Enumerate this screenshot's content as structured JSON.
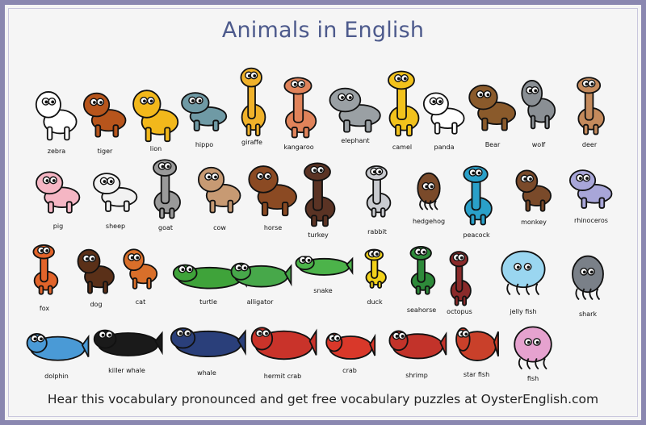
{
  "title": "Animals in English",
  "footer": "Hear this vocabulary pronounced and get free vocabulary puzzles at OysterEnglish.com",
  "animals": [
    {
      "label": "zebra",
      "color": "#ffffff"
    },
    {
      "label": "tiger",
      "color": "#b7551c"
    },
    {
      "label": "lion",
      "color": "#f2b81b"
    },
    {
      "label": "hippo",
      "color": "#6f9aa5"
    },
    {
      "label": "giraffe",
      "color": "#f0b22a"
    },
    {
      "label": "kangaroo",
      "color": "#e0835a"
    },
    {
      "label": "elephant",
      "color": "#9aa0a4"
    },
    {
      "label": "camel",
      "color": "#f2c21c"
    },
    {
      "label": "panda",
      "color": "#ffffff"
    },
    {
      "label": "Bear",
      "color": "#8a5a2b"
    },
    {
      "label": "wolf",
      "color": "#8a8f94"
    },
    {
      "label": "deer",
      "color": "#c48a5c"
    },
    {
      "label": "pig",
      "color": "#f5b6c4"
    },
    {
      "label": "sheep",
      "color": "#f2f2f2"
    },
    {
      "label": "goat",
      "color": "#9a9a9a"
    },
    {
      "label": "cow",
      "color": "#c79a73"
    },
    {
      "label": "horse",
      "color": "#8b4a23"
    },
    {
      "label": "turkey",
      "color": "#5a3324"
    },
    {
      "label": "rabbit",
      "color": "#c9cbd0"
    },
    {
      "label": "hedgehog",
      "color": "#7a4a2a"
    },
    {
      "label": "peacock",
      "color": "#2aa0c9"
    },
    {
      "label": "monkey",
      "color": "#7a4a2a"
    },
    {
      "label": "rhinoceros",
      "color": "#a8a6d8"
    },
    {
      "label": "fox",
      "color": "#e2642a"
    },
    {
      "label": "dog",
      "color": "#5a3018"
    },
    {
      "label": "cat",
      "color": "#d96f2a"
    },
    {
      "label": "turtle",
      "color": "#3fa33a"
    },
    {
      "label": "alligator",
      "color": "#47a84a"
    },
    {
      "label": "snake",
      "color": "#4cb34a"
    },
    {
      "label": "duck",
      "color": "#f2d21a"
    },
    {
      "label": "seahorse",
      "color": "#2e8a3a"
    },
    {
      "label": "octopus",
      "color": "#8a2a2a"
    },
    {
      "label": "jelly fish",
      "color": "#9ad6f0"
    },
    {
      "label": "shark",
      "color": "#7a8088"
    },
    {
      "label": "dolphin",
      "color": "#4a9ad6"
    },
    {
      "label": "killer whale",
      "color": "#1a1a1a"
    },
    {
      "label": "whale",
      "color": "#2a3f7a"
    },
    {
      "label": "hermit crab",
      "color": "#c9332a"
    },
    {
      "label": "crab",
      "color": "#d9382a"
    },
    {
      "label": "shrimp",
      "color": "#c2332a"
    },
    {
      "label": "star fish",
      "color": "#c9402a"
    },
    {
      "label": "fish",
      "color": "#e6a2cf"
    }
  ]
}
